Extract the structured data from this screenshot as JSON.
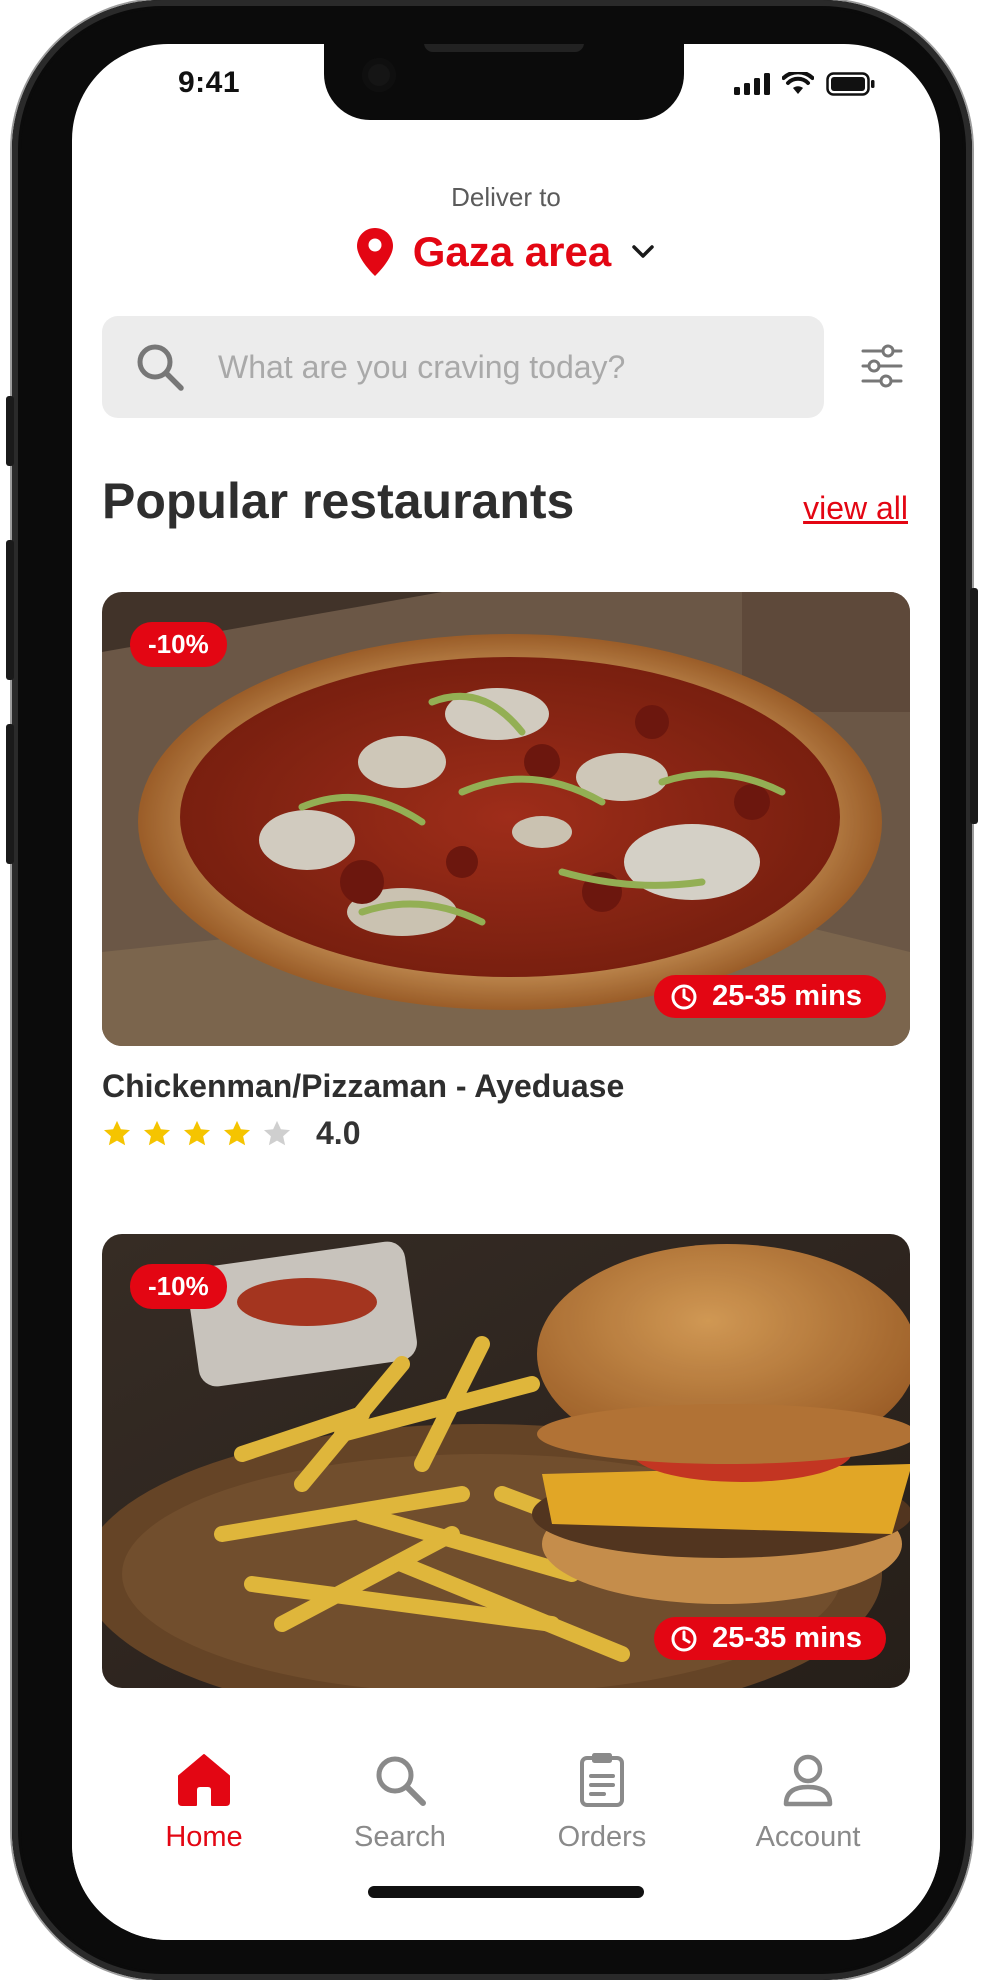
{
  "status_bar": {
    "time": "9:41"
  },
  "header": {
    "deliver_label": "Deliver to",
    "location": "Gaza area"
  },
  "search": {
    "placeholder": "What are you craving today?",
    "value": ""
  },
  "section": {
    "title": "Popular restaurants",
    "view_all": "view all"
  },
  "restaurants": [
    {
      "name": "Chickenman/Pizzaman - Ayeduase",
      "discount": "-10%",
      "delivery_time": "25-35 mins",
      "rating": 4,
      "rating_text": "4.0",
      "image_icon": "pizza-photo"
    },
    {
      "discount": "-10%",
      "delivery_time": "25-35 mins",
      "image_icon": "burger-fries-photo"
    }
  ],
  "nav": {
    "items": [
      {
        "label": "Home",
        "icon": "home-icon",
        "active": true
      },
      {
        "label": "Search",
        "icon": "search-icon",
        "active": false
      },
      {
        "label": "Orders",
        "icon": "clipboard-icon",
        "active": false
      },
      {
        "label": "Account",
        "icon": "user-icon",
        "active": false
      }
    ]
  },
  "colors": {
    "accent": "#e30613",
    "text_dark": "#2e2e2e",
    "text_muted": "#8a8a8a",
    "star": "#f5c400",
    "star_empty": "#cfcfcf"
  }
}
